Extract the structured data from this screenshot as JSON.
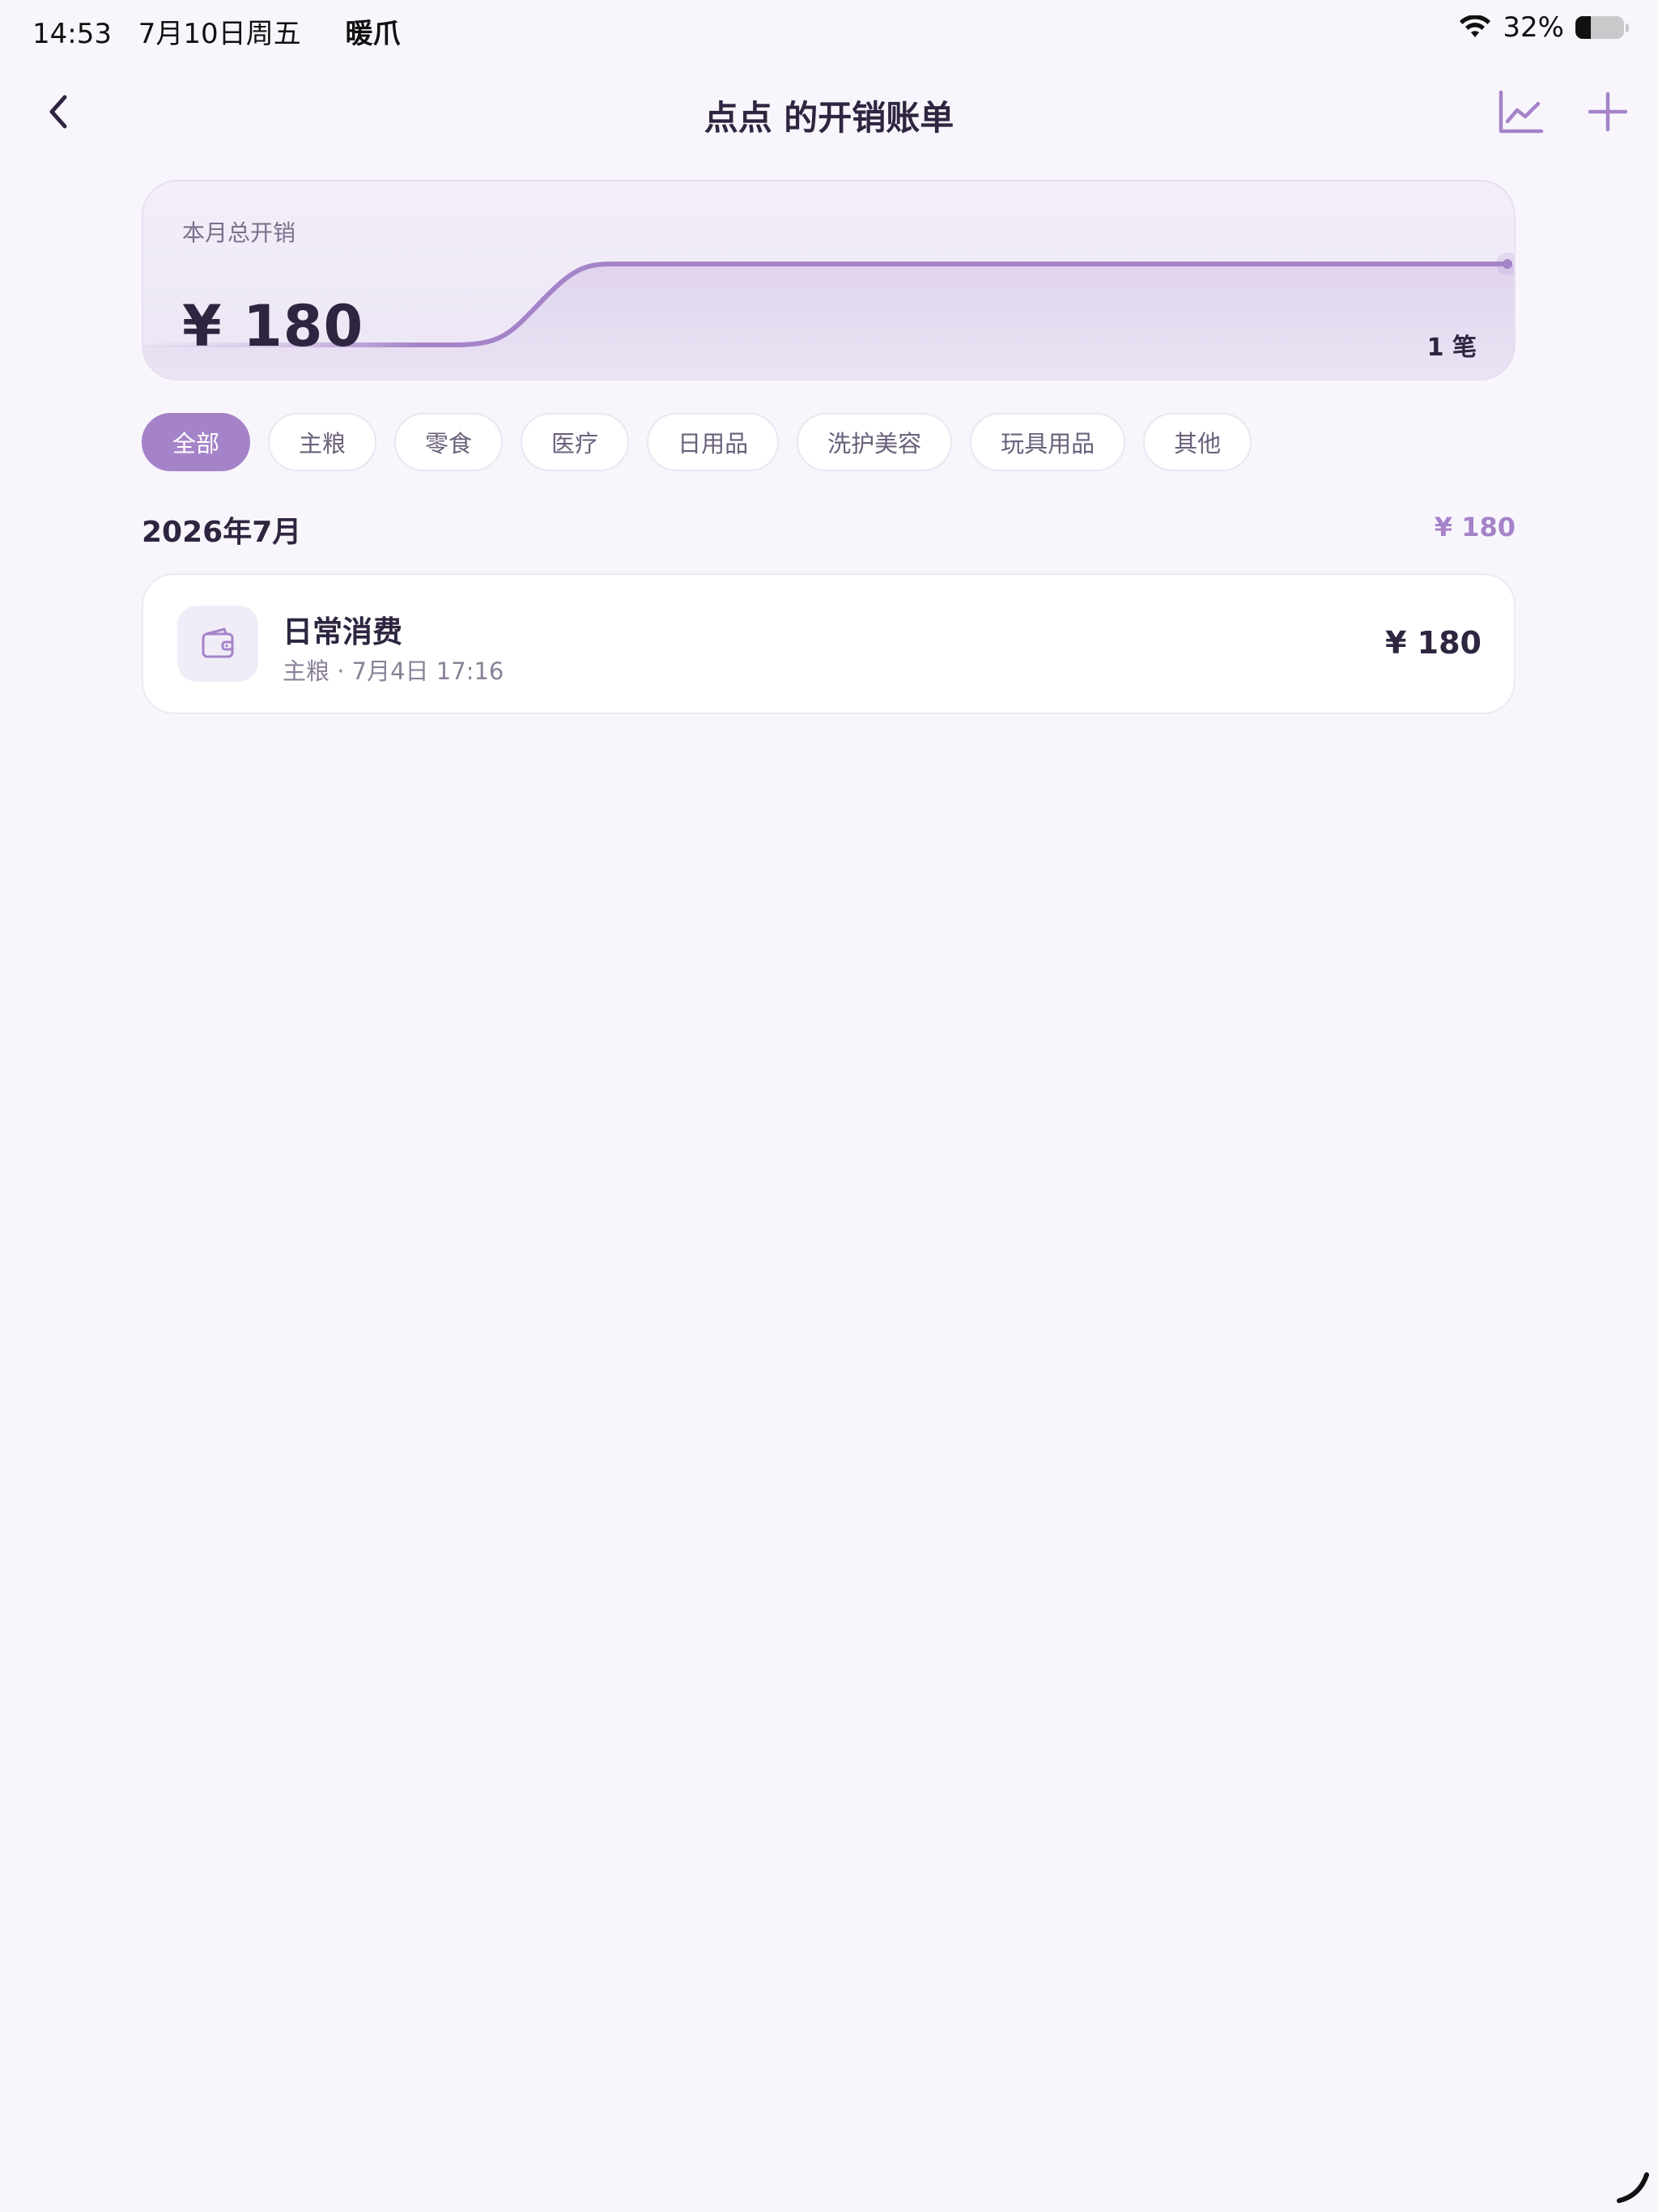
{
  "status_bar": {
    "time": "14:53",
    "date": "7月10日周五",
    "app_name": "暖爪",
    "battery_text": "32%",
    "battery_level": 0.32
  },
  "nav": {
    "title": "点点 的开销账单",
    "back_icon": "chevron-left-icon",
    "chart_icon": "line-chart-icon",
    "add_icon": "plus-icon"
  },
  "summary": {
    "label": "本月总开销",
    "amount": "¥ 180",
    "count": "1 笔"
  },
  "filters": {
    "items": [
      "全部",
      "主粮",
      "零食",
      "医疗",
      "日用品",
      "洗护美容",
      "玩具用品",
      "其他"
    ],
    "selected": "全部"
  },
  "month": {
    "title": "2026年7月",
    "total": "¥ 180"
  },
  "expenses": [
    {
      "title": "日常消费",
      "meta": "主粮 · 7月4日 17:16",
      "amount": "¥ 180",
      "icon": "wallet-icon"
    }
  ],
  "colors": {
    "accent": "#a583c9",
    "text_primary": "#2e2640",
    "text_secondary": "#8a8198",
    "background": "#f8f6fc"
  }
}
